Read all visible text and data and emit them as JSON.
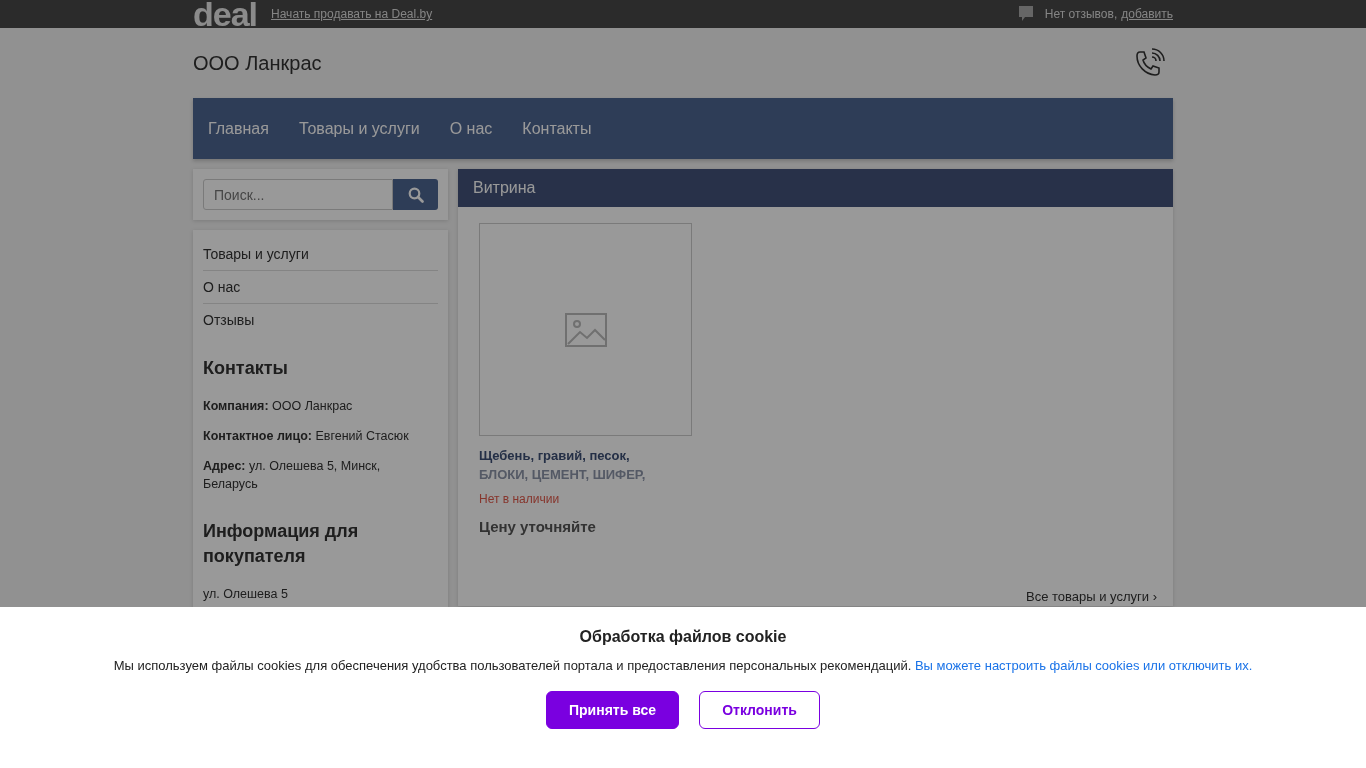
{
  "top_bar": {
    "logo": "deal",
    "sell_link": "Начать продавать на Deal.by",
    "reviews_text": "Нет отзывов,",
    "reviews_link": "добавить"
  },
  "company": {
    "name": "ООО Ланкрас"
  },
  "nav": [
    {
      "label": "Главная"
    },
    {
      "label": "Товары и услуги"
    },
    {
      "label": "О нас"
    },
    {
      "label": "Контакты"
    }
  ],
  "search": {
    "placeholder": "Поиск..."
  },
  "sidebar": {
    "items": [
      {
        "label": "Товары и услуги"
      },
      {
        "label": "О нас"
      },
      {
        "label": "Отзывы"
      }
    ],
    "contacts_title": "Контакты",
    "contacts": [
      {
        "label": "Компания:",
        "value": "ООО Ланкрас"
      },
      {
        "label": "Контактное лицо:",
        "value": "Евгений Стасюк"
      },
      {
        "label": "Адрес:",
        "value": "ул. Олешева 5, Минск, Беларусь"
      }
    ],
    "info_title": "Информация для покупателя",
    "info_text": "ул. Олешева 5"
  },
  "showcase": {
    "title": "Витрина",
    "products": [
      {
        "name": "Щебень, гравий, песок,",
        "subtitle": "БЛОКИ, ЦЕМЕНТ, ШИФЕР,",
        "availability": "Нет в наличии",
        "price": "Цену уточняйте"
      }
    ],
    "all_link": "Все товары и услуги ›"
  },
  "cookie_banner": {
    "title": "Обработка файлов cookie",
    "text": "Мы используем файлы cookies для обеспечения удобства пользователей портала и предоставления персональных рекомендаций.",
    "link": "Вы можете настроить файлы cookies или отключить их.",
    "buttons": [
      {
        "label": "Принять все",
        "kind": "primary"
      },
      {
        "label": "Отклонить",
        "kind": "secondary"
      }
    ]
  }
}
